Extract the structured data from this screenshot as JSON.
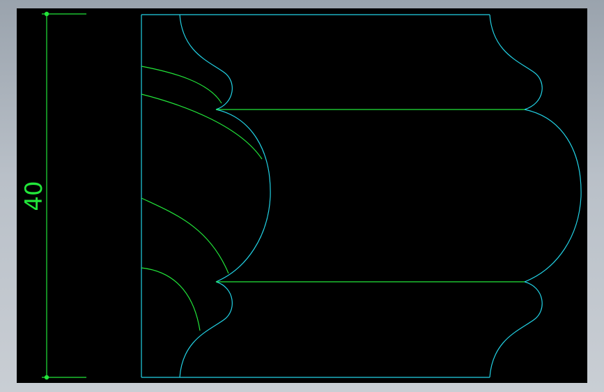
{
  "drawing": {
    "dimension_value": "40",
    "colors": {
      "background": "#000000",
      "outline": "#22d3e6",
      "dimension": "#22e63a",
      "hatch_curve": "#22e63a",
      "frame": "#a9b1ba"
    }
  }
}
